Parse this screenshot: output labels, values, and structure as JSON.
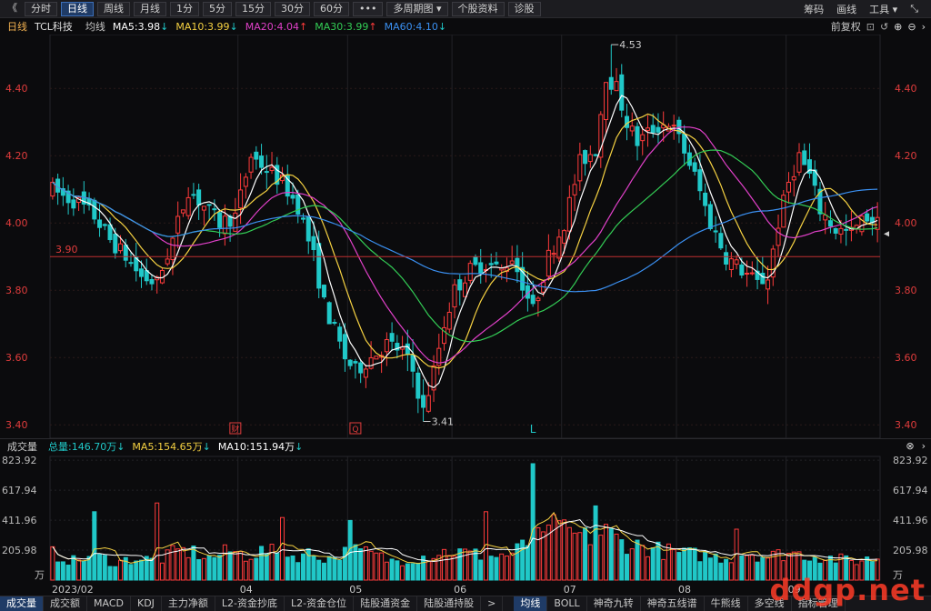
{
  "toolbar": {
    "back": "《",
    "buttons": [
      "分时",
      "日线",
      "周线",
      "月线",
      "1分",
      "5分",
      "15分",
      "30分",
      "60分",
      "•••",
      "多周期图 ▾",
      "个股资料",
      "诊股"
    ],
    "active_index": 1,
    "right": [
      "筹码",
      "画线",
      "工具 ▾",
      "⤡"
    ]
  },
  "legend": {
    "period": "日线",
    "stock": "TCL科技",
    "ma_label": "均线",
    "ma5": "MA5:3.98",
    "ma10": "MA10:3.99",
    "ma20": "MA20:4.04",
    "ma30": "MA30:3.99",
    "ma60": "MA60:4.10",
    "adjust": "前复权",
    "colors": {
      "ma5": "#ffffff",
      "ma10": "#f5d142",
      "ma20": "#e040c8",
      "ma30": "#33cc55",
      "ma60": "#3a8ff0",
      "up": "#ff3b3b",
      "down": "#20c8c8"
    }
  },
  "volume_legend": {
    "title": "成交量",
    "total": "总量:146.70万",
    "ma5": "MA5:154.65万",
    "ma10": "MA10:151.94万"
  },
  "bottom_tabs": {
    "left": [
      "成交量",
      "成交额",
      "MACD",
      "KDJ",
      "主力净额",
      "L2-资金抄底",
      "L2-资金仓位",
      "陆股通资金",
      "陆股通持股",
      ">"
    ],
    "right": [
      "均线",
      "BOLL",
      "神奇九转",
      "神奇五线谱",
      "牛熊线",
      "多空线",
      "指标管理"
    ],
    "active_left": 0,
    "active_right": 0
  },
  "watermark": "ddgp.net",
  "chart_data": {
    "type": "candlestick",
    "price_axis": {
      "ticks": [
        4.4,
        4.2,
        4.0,
        3.8,
        3.6,
        3.4
      ],
      "range": [
        3.36,
        4.56
      ]
    },
    "volume_axis": {
      "ticks": [
        823.92,
        617.94,
        411.96,
        205.98
      ],
      "unit": "万",
      "range": [
        0,
        850
      ]
    },
    "x_labels": [
      {
        "label": "2023/02",
        "index": 0
      },
      {
        "label": "04",
        "index": 36
      },
      {
        "label": "05",
        "index": 57
      },
      {
        "label": "06",
        "index": 77
      },
      {
        "label": "07",
        "index": 98
      },
      {
        "label": "08",
        "index": 120
      },
      {
        "label": "09",
        "index": 141
      }
    ],
    "reference_line": {
      "value": 3.9,
      "label": "3.90"
    },
    "high_annotation": {
      "value": 4.53,
      "label": "4.53",
      "index": 107
    },
    "low_annotation": {
      "value": 3.41,
      "label": "3.41",
      "index": 71
    },
    "markers": [
      {
        "label": "财",
        "index": 35
      },
      {
        "label": "Q",
        "index": 58
      },
      {
        "label": "L",
        "index": 92
      }
    ],
    "price_knots": [
      [
        0,
        4.1
      ],
      [
        2,
        4.08
      ],
      [
        5,
        4.06
      ],
      [
        8,
        4.02
      ],
      [
        11,
        3.95
      ],
      [
        14,
        3.9
      ],
      [
        17,
        3.84
      ],
      [
        20,
        3.82
      ],
      [
        23,
        3.95
      ],
      [
        26,
        4.1
      ],
      [
        29,
        4.05
      ],
      [
        32,
        4.0
      ],
      [
        35,
        4.02
      ],
      [
        38,
        4.2
      ],
      [
        41,
        4.16
      ],
      [
        44,
        4.12
      ],
      [
        47,
        4.05
      ],
      [
        50,
        3.9
      ],
      [
        52,
        3.76
      ],
      [
        54,
        3.68
      ],
      [
        56,
        3.6
      ],
      [
        58,
        3.56
      ],
      [
        61,
        3.6
      ],
      [
        64,
        3.64
      ],
      [
        67,
        3.62
      ],
      [
        69,
        3.56
      ],
      [
        71,
        3.44
      ],
      [
        73,
        3.56
      ],
      [
        75,
        3.7
      ],
      [
        77,
        3.8
      ],
      [
        80,
        3.86
      ],
      [
        83,
        3.88
      ],
      [
        86,
        3.86
      ],
      [
        88,
        3.9
      ],
      [
        90,
        3.82
      ],
      [
        92,
        3.74
      ],
      [
        95,
        3.9
      ],
      [
        98,
        4.0
      ],
      [
        101,
        4.18
      ],
      [
        104,
        4.22
      ],
      [
        106,
        4.44
      ],
      [
        108,
        4.4
      ],
      [
        110,
        4.3
      ],
      [
        112,
        4.24
      ],
      [
        115,
        4.28
      ],
      [
        118,
        4.3
      ],
      [
        120,
        4.25
      ],
      [
        123,
        4.14
      ],
      [
        126,
        4.0
      ],
      [
        129,
        3.9
      ],
      [
        132,
        3.86
      ],
      [
        135,
        3.82
      ],
      [
        137,
        3.84
      ],
      [
        139,
        4.0
      ],
      [
        141,
        4.12
      ],
      [
        143,
        4.2
      ],
      [
        145,
        4.14
      ],
      [
        147,
        4.04
      ],
      [
        150,
        3.98
      ],
      [
        153,
        3.97
      ],
      [
        156,
        4.02
      ],
      [
        158,
        4.0
      ]
    ],
    "volume_knots": [
      [
        0,
        180
      ],
      [
        4,
        130
      ],
      [
        8,
        170
      ],
      [
        12,
        120
      ],
      [
        16,
        150
      ],
      [
        20,
        130
      ],
      [
        24,
        200
      ],
      [
        27,
        190
      ],
      [
        30,
        150
      ],
      [
        34,
        200
      ],
      [
        37,
        170
      ],
      [
        41,
        200
      ],
      [
        45,
        160
      ],
      [
        49,
        180
      ],
      [
        53,
        150
      ],
      [
        57,
        200
      ],
      [
        61,
        180
      ],
      [
        65,
        130
      ],
      [
        69,
        150
      ],
      [
        72,
        170
      ],
      [
        76,
        200
      ],
      [
        80,
        180
      ],
      [
        84,
        160
      ],
      [
        88,
        180
      ],
      [
        91,
        250
      ],
      [
        93,
        280
      ],
      [
        95,
        300
      ],
      [
        98,
        330
      ],
      [
        102,
        290
      ],
      [
        106,
        330
      ],
      [
        109,
        260
      ],
      [
        113,
        230
      ],
      [
        117,
        200
      ],
      [
        121,
        180
      ],
      [
        125,
        170
      ],
      [
        129,
        150
      ],
      [
        133,
        190
      ],
      [
        137,
        160
      ],
      [
        141,
        190
      ],
      [
        145,
        170
      ],
      [
        149,
        150
      ],
      [
        153,
        130
      ],
      [
        158,
        150
      ]
    ],
    "volume_spikes": [
      [
        8,
        470
      ],
      [
        20,
        530
      ],
      [
        44,
        430
      ],
      [
        57,
        410
      ],
      [
        83,
        470
      ],
      [
        92,
        800
      ],
      [
        96,
        450
      ],
      [
        104,
        510
      ],
      [
        131,
        350
      ]
    ],
    "num_bars": 159
  }
}
